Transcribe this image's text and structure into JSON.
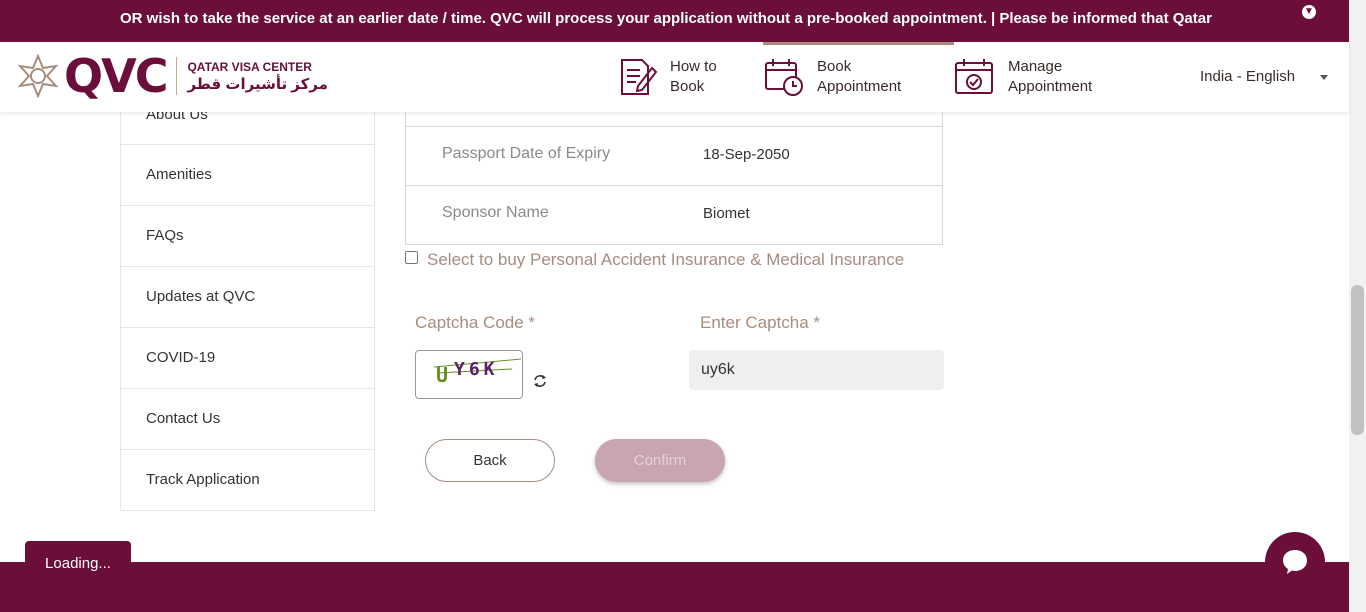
{
  "announcement": {
    "text": "OR wish to take the service at an earlier date / time. QVC will process your application without a pre-booked appointment. | Please be informed that Qatar"
  },
  "header": {
    "logo_word": "QVC",
    "logo_en": "QATAR VISA CENTER",
    "logo_ar": "مركز تأشيرات قطر",
    "nav": [
      {
        "label_line1": "How to",
        "label_line2": "Book",
        "icon": "document-pen-icon"
      },
      {
        "label_line1": "Book",
        "label_line2": "Appointment",
        "icon": "calendar-clock-icon",
        "active": true
      },
      {
        "label_line1": "Manage",
        "label_line2": "Appointment",
        "icon": "calendar-check-icon"
      }
    ],
    "language": "India - English"
  },
  "sidebar": {
    "items": [
      {
        "label": "About Us"
      },
      {
        "label": "Amenities"
      },
      {
        "label": "FAQs"
      },
      {
        "label": "Updates at QVC"
      },
      {
        "label": "COVID-19"
      },
      {
        "label": "Contact Us"
      },
      {
        "label": "Track Application"
      }
    ]
  },
  "details": {
    "rows": [
      {
        "key": "Passport Date of Expiry",
        "value": "18-Sep-2050"
      },
      {
        "key": "Sponsor Name",
        "value": "Biomet"
      }
    ]
  },
  "insurance": {
    "label": "Select to buy Personal Accident Insurance & Medical Insurance",
    "checked": false
  },
  "captcha": {
    "code_label": "Captcha Code *",
    "enter_label": "Enter Captcha *",
    "image_text": "UY6K",
    "input_value": "uy6k"
  },
  "buttons": {
    "back": "Back",
    "confirm": "Confirm"
  },
  "status": {
    "loading": "Loading..."
  },
  "colors": {
    "brand": "#6b0e3a",
    "accent": "#a88c7d",
    "confirm_disabled": "#c9a4b2"
  }
}
